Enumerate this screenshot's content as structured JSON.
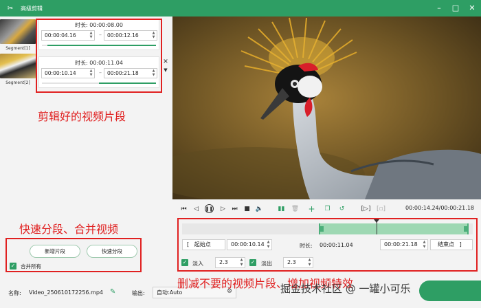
{
  "window": {
    "title": "高级剪辑"
  },
  "segments": [
    {
      "label": "Segment[1]",
      "duration_label": "时长",
      "duration": "00:00:08.00",
      "start": "00:00:04.16",
      "end": "00:00:12.16",
      "bar_start": 0.05,
      "bar_end": 1.0
    },
    {
      "label": "Segment[2]",
      "duration_label": "时长",
      "duration": "00:00:11.04",
      "start": "00:00:10.14",
      "end": "00:00:21.18",
      "bar_start": 0.5,
      "bar_end": 1.0
    }
  ],
  "annotations": {
    "segments": "剪辑好的视频片段",
    "split_merge": "快速分段、合并视频",
    "trim": "删减不要的视频片段、增加视频特效"
  },
  "buttons": {
    "new_segment": "新增片段",
    "quick_split": "快速分段",
    "merge_all": "合并所有"
  },
  "player": {
    "current_time": "00:00:14.24",
    "total_time": "00:00:21.18",
    "time_sep": "/"
  },
  "trim": {
    "start_point_label": "起始点",
    "start_value": "00:00:10.14",
    "duration_label": "时长",
    "duration_value": "00:00:11.04",
    "end_value": "00:00:21.18",
    "end_point_label": "结束点",
    "fade_in_label": "淡入",
    "fade_in_value": "2.3",
    "fade_out_label": "淡出",
    "fade_out_value": "2.3",
    "selection_start": 0.47,
    "selection_end": 1.0,
    "playhead": 0.67
  },
  "footer": {
    "name_label": "名称",
    "name_value": "Video_250610172256.mp4",
    "output_label": "输出",
    "output_value": "自动:Auto"
  },
  "watermark": "掘金技术社区 @ 一罐小可乐",
  "colors": {
    "accent": "#2e9e64",
    "annotation": "#e02020"
  },
  "icons": [
    "app-logo-icon",
    "minimize-icon",
    "maximize-icon",
    "close-icon",
    "edit-icon",
    "gear-icon"
  ]
}
